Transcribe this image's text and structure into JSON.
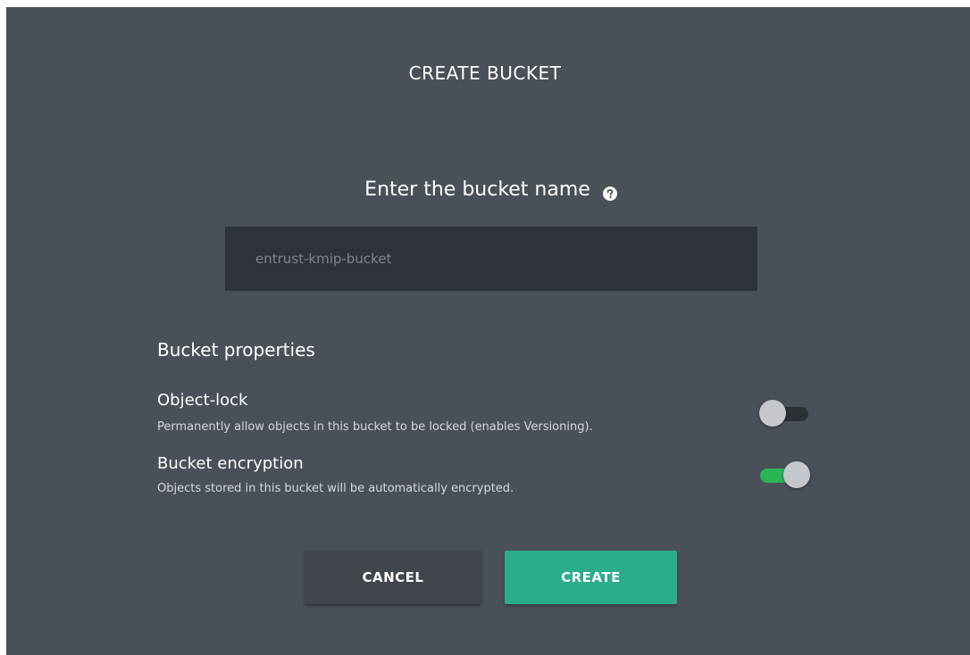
{
  "dialog": {
    "title": "CREATE BUCKET",
    "name_label": "Enter the bucket name",
    "help_icon": "question-circle-icon",
    "input": {
      "value": "",
      "placeholder": "entrust-kmip-bucket"
    }
  },
  "properties": {
    "heading": "Bucket properties",
    "object_lock": {
      "title": "Object-lock",
      "description": "Permanently allow objects in this bucket to be locked (enables Versioning).",
      "enabled": false
    },
    "encryption": {
      "title": "Bucket encryption",
      "description": "Objects stored in this bucket will be automatically encrypted.",
      "enabled": true
    }
  },
  "actions": {
    "cancel_label": "CANCEL",
    "create_label": "CREATE"
  },
  "colors": {
    "background": "#4a5057",
    "input_background": "#2e3339",
    "toggle_on": "#2cb557",
    "toggle_off": "#2b3035",
    "create_button": "#2bac8b",
    "cancel_button": "#41464d"
  }
}
